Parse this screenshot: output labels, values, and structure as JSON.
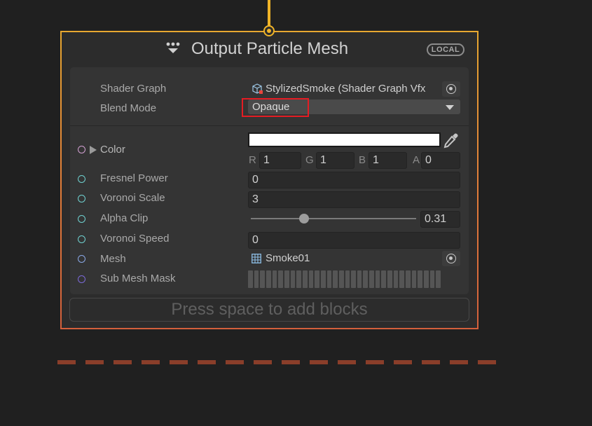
{
  "node": {
    "title": "Output Particle Mesh",
    "badge": "LOCAL",
    "title_icon": "vfx-output-icon",
    "accent_color": "#f0b428"
  },
  "settings": {
    "shader_graph": {
      "label": "Shader Graph",
      "value": "StylizedSmoke (Shader Graph Vfx"
    },
    "blend_mode": {
      "label": "Blend Mode",
      "value": "Opaque"
    }
  },
  "properties": {
    "color": {
      "label": "Color",
      "value_hex": "#ffffff",
      "channels": [
        {
          "name": "R",
          "value": "1"
        },
        {
          "name": "G",
          "value": "1"
        },
        {
          "name": "B",
          "value": "1"
        },
        {
          "name": "A",
          "value": "0"
        }
      ]
    },
    "fresnel_power": {
      "label": "Fresnel Power",
      "value": "0"
    },
    "voronoi_scale": {
      "label": "Voronoi Scale",
      "value": "3"
    },
    "alpha_clip": {
      "label": "Alpha Clip",
      "value": "0.31"
    },
    "voronoi_speed": {
      "label": "Voronoi Speed",
      "value": "0"
    },
    "mesh": {
      "label": "Mesh",
      "value": "Smoke01"
    },
    "sub_mesh_mask": {
      "label": "Sub Mesh Mask"
    }
  },
  "footer": {
    "add_blocks": "Press space to add blocks"
  }
}
